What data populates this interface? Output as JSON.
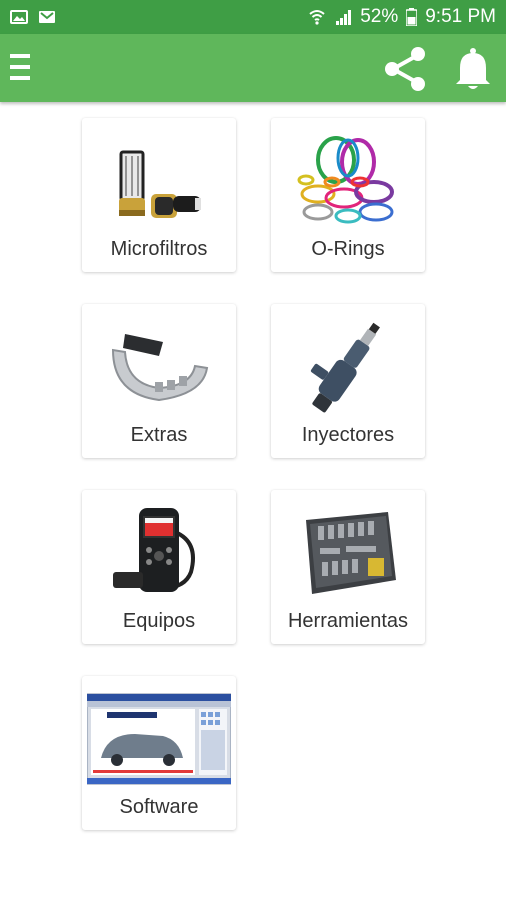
{
  "status_bar": {
    "battery": "52%",
    "time": "9:51 PM"
  },
  "app_bar": {
    "menu_icon": "hamburger-menu-icon",
    "share_icon": "share-icon",
    "notifications_icon": "bell-icon"
  },
  "categories": [
    {
      "label": "Microfiltros"
    },
    {
      "label": "O-Rings"
    },
    {
      "label": "Extras"
    },
    {
      "label": "Inyectores"
    },
    {
      "label": "Equipos"
    },
    {
      "label": "Herramientas"
    },
    {
      "label": "Software"
    }
  ],
  "colors": {
    "status_bar": "#3f9e45",
    "app_bar": "#5fb75b"
  }
}
